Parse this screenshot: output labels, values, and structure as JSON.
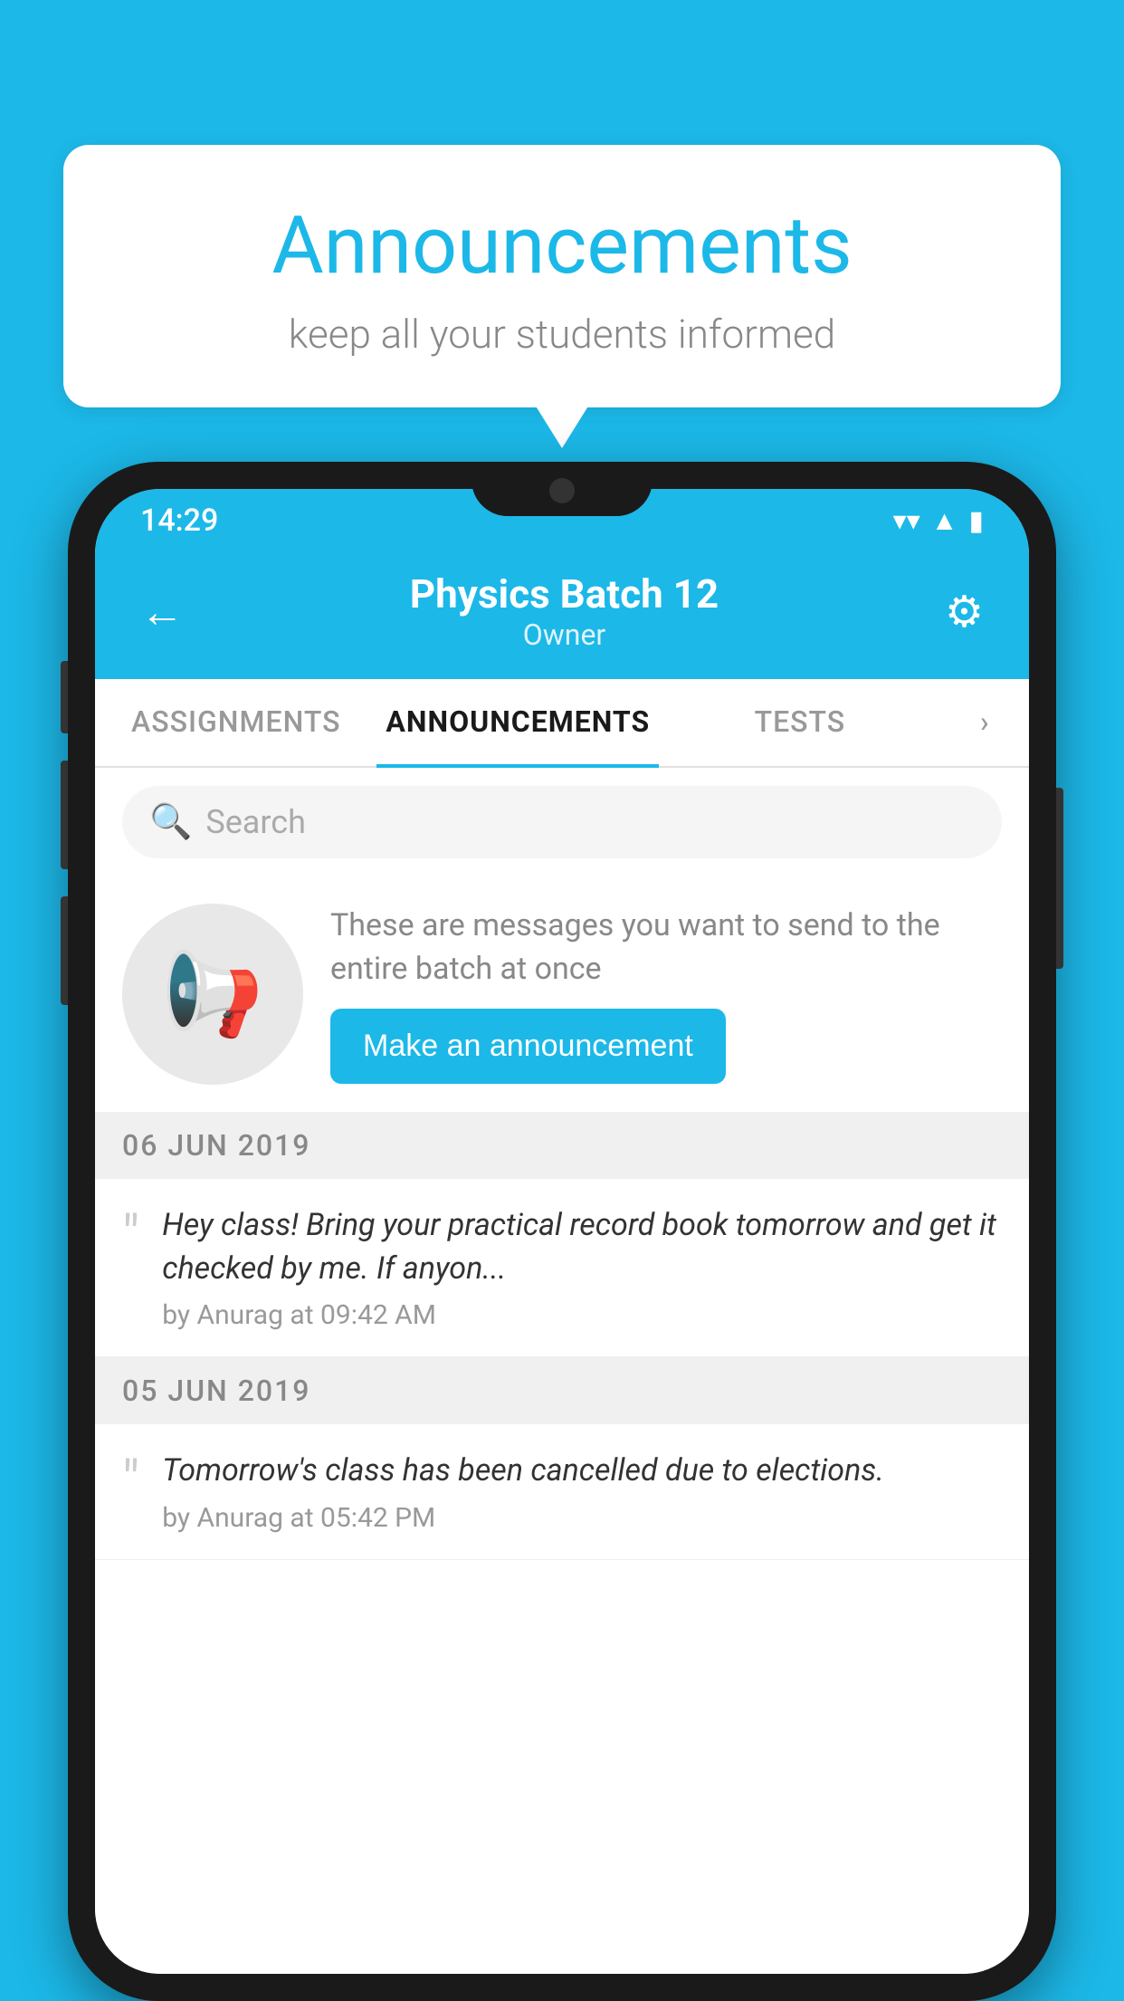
{
  "background_color": "#1cb8e8",
  "speech_bubble": {
    "title": "Announcements",
    "subtitle": "keep all your students informed"
  },
  "status_bar": {
    "time": "14:29",
    "wifi_icon": "▼",
    "signal_icon": "▲",
    "battery_icon": "▮"
  },
  "header": {
    "back_icon": "←",
    "title": "Physics Batch 12",
    "subtitle": "Owner",
    "gear_icon": "⚙"
  },
  "tabs": [
    {
      "label": "ASSIGNMENTS",
      "active": false
    },
    {
      "label": "ANNOUNCEMENTS",
      "active": true
    },
    {
      "label": "TESTS",
      "active": false
    },
    {
      "label": "›",
      "active": false
    }
  ],
  "search": {
    "placeholder": "Search",
    "icon": "🔍"
  },
  "promo": {
    "text": "These are messages you want to send to the entire batch at once",
    "button_label": "Make an announcement",
    "megaphone": "📢"
  },
  "announcements": [
    {
      "date": "06  JUN  2019",
      "items": [
        {
          "text": "Hey class! Bring your practical record book tomorrow and get it checked by me. If anyon...",
          "author": "by Anurag at 09:42 AM"
        }
      ]
    },
    {
      "date": "05  JUN  2019",
      "items": [
        {
          "text": "Tomorrow's class has been cancelled due to elections.",
          "author": "by Anurag at 05:42 PM"
        }
      ]
    }
  ]
}
